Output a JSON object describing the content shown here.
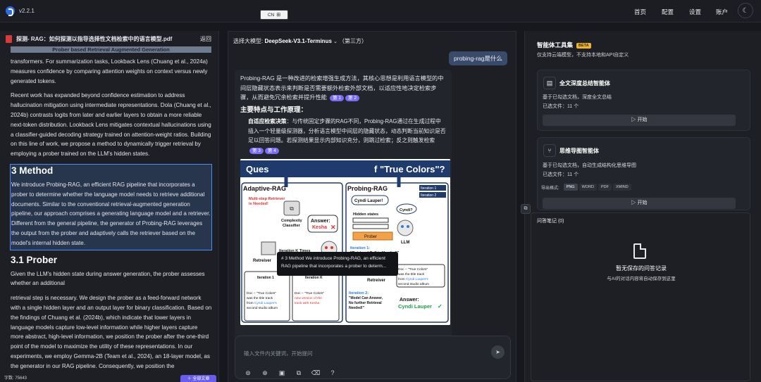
{
  "header": {
    "version": "v2.2.1",
    "lang_label": "CN",
    "lang_icon": "translate-icon",
    "nav": [
      "首页",
      "配置",
      "设置",
      "账户"
    ],
    "theme_icon": "moon-icon"
  },
  "doc_panel": {
    "filename": "探测- RAG：如何探测以指导选择性文档检索中的语言模型.pdf",
    "back_label": "返回",
    "clipped_heading": "Prober based Retrieval Augmented Generation",
    "p1": "transformers. For summarization tasks, Lookback Lens (Chuang et al., 2024a) measures confidence by comparing attention weights on context versus newly generated tokens.",
    "p2": "Recent work has expanded beyond confidence estimation to address hallucination mitigation using intermediate representations. Dola (Chuang et al., 2024b) contrasts logits from later and earlier layers to obtain a more reliable next-token distribution. Lookback Lens mitigates contextual hallucinations using a classifier-guided decoding strategy trained on attention-weight ratios. Building on this line of work, we propose a method to dynamically trigger retrieval by employing a prober trained on the LLM's hidden states.",
    "h_method": "3 Method",
    "p_method": "We introduce Probing-RAG, an efficient RAG pipeline that incorporates a prober to determine whether the language model needs to retrieve additional documents. Similar to the conventional retrieval-augmented generation pipeline, our approach comprises a generating language model and a retriever. Different from the general pipeline, the generator of Probing-RAG leverages the output from the prober and adaptively calls the retriever based on the model's internal hidden state.",
    "h_prober": "3.1 Prober",
    "p3": "Given the LLM's hidden state during answer generation, the prober assesses whether an additional",
    "p4": "retrieval step is necessary. We design the prober as a feed-forward network with a single hidden layer and an output layer for binary classification. Based on the findings of Chuang et al. (2024b), which indicate that lower layers in language models capture low-level information while higher layers capture more abstract, high-level information, we position the prober after the one-third point of the model to maximize the utility of these representations. In our experiments, we employ Gemma-2B (Team et al., 2024), an 18-layer model, as the generator in our RAG pipeline. Consequently, we position the",
    "word_count": "字数: 75643",
    "full_text_button": "全部文章"
  },
  "chat": {
    "model_prefix": "选择大模型: ",
    "model_name": "DeepSeek-V3.1-Terminus",
    "model_suffix": "（第三方）",
    "user_message": "probing-rag是什么",
    "answer_intro": "Probing-RAG 是一种改进的检索增强生成方法，其核心思想是利用语言模型的中间层隐藏状态表示来判断是否需要额外检索外部文档，以适应性地决定检索步骤，从而避免冗余检索并提升性能",
    "cite1": "第 1",
    "cite2": "第 2",
    "section_title": "主要特点与工作原理：",
    "bullet_title": "自适应检索决策",
    "bullet_text": "：与传统固定步骤的RAG不同，Probing-RAG通过在生成过程中插入一个轻量级探测器，分析语言模型中间层的隐藏状态，动态判断当前知识是否足以回答问题。若探测结果显示内部知识充分，则跳过检索；反之则触发检索",
    "cite3": "第 3",
    "cite4": "第 4",
    "tooltip": "# 3 Method We introduce Probing-RAG, an efficient RAG pipeline that incorporates a prober to determ...",
    "input_placeholder": "输入文件内关键词，开始提问",
    "send_icon": "send-icon",
    "figure": {
      "banner": "Question: Who performed \"True Colors\"?",
      "banner_start": "Ques",
      "banner_end": "f \"True Colors\"?",
      "left_title": "Adaptive-RAG",
      "right_title": "Probing-RAG",
      "multi_step": "Multi-step Retriever is Needed!",
      "complexity": "Complexity Classifier",
      "answer_label": "Answer:",
      "answer_wrong": "Kesha",
      "iteration_k_times": "Iteration K Times",
      "retreiver": "Retreiver",
      "llm": "LLM",
      "iteration1": "Iteration 1",
      "iterationk": "Iteration K",
      "doc_left1": "Doc – \"True Colors\" was the title track from Cyndi Lauper's second studio album",
      "doc_left2": "Doc – \"True Colors\" new version of the track with Kesha",
      "legend1": "Iteration 1",
      "legend2": "Iteration 2",
      "cyndi": "Cyndi Lauper!",
      "cyndi_q": "Cyndi?",
      "hidden_states": "Hidden states",
      "prober": "Prober",
      "iter1_note": "Iteration 1: \"Retrieval Call is Needed!\"",
      "retreiver_r": "Retreiver",
      "doc_right": "Doc – \"True Colors\" was the title track from Cyndi Lauper's second studio album",
      "iter2_note": "Iteration 2: \"Model Can Answer, No further Retrieval Needed!\"",
      "answer_right_label": "Answer:",
      "answer_right": "Cyndi Lauper"
    }
  },
  "tools_panel": {
    "title": "智能体工具集",
    "badge": "BETA",
    "subtitle": "仅支持云端模型，不支持本地和API自定义",
    "card1": {
      "title": "全文深度总结智能体",
      "desc": "基于已勾选文档，深度全文总结",
      "count": "已选文件：11 个",
      "button": "开始"
    },
    "card2": {
      "title": "思维导图智能体",
      "desc": "基于已勾选文档，自动生成结构化思维导图",
      "count": "已选文件：11 个",
      "export_label": "导出格式:",
      "formats": [
        "PNG",
        "WORD",
        "PDF",
        "XMIND"
      ],
      "button": "开始"
    },
    "notes": {
      "title": "问答笔记 (0)",
      "empty": "暂无保存的问答记录",
      "hint": "与AI的对话内容将自动保存到这里"
    }
  }
}
